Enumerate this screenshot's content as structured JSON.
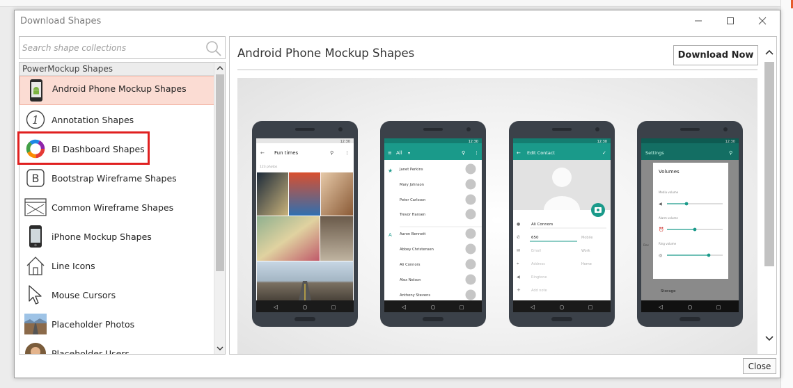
{
  "window": {
    "title": "Download Shapes"
  },
  "search": {
    "placeholder": "Search shape collections"
  },
  "sidebar": {
    "group_label": "PowerMockup Shapes",
    "items": [
      {
        "label": "Android Phone Mockup Shapes",
        "icon": "android-phone-icon",
        "selected": true
      },
      {
        "label": "Annotation Shapes",
        "icon": "annotation-number-icon"
      },
      {
        "label": "BI Dashboard Shapes",
        "icon": "donut-chart-icon"
      },
      {
        "label": "Bootstrap Wireframe Shapes",
        "icon": "bootstrap-b-icon"
      },
      {
        "label": "Common Wireframe Shapes",
        "icon": "wireframe-window-icon"
      },
      {
        "label": "iPhone Mockup Shapes",
        "icon": "iphone-icon"
      },
      {
        "label": "Line Icons",
        "icon": "house-outline-icon"
      },
      {
        "label": "Mouse Cursors",
        "icon": "cursor-arrow-icon"
      },
      {
        "label": "Placeholder Photos",
        "icon": "landscape-photo-icon"
      },
      {
        "label": "Placeholder Users",
        "icon": "user-photo-icon"
      }
    ]
  },
  "detail": {
    "title": "Android Phone Mockup Shapes",
    "download_label": "Download Now"
  },
  "phones": [
    {
      "status_time": "12:30",
      "appbar_title": "Fun times",
      "subtitle": "123 photos"
    },
    {
      "status_time": "12:30",
      "appbar_title": "All",
      "contacts": [
        "Janet Perkins",
        "Mary Johnson",
        "Peter Carlsson",
        "Trevor Hansen",
        "Aaron Bennett",
        "Abbey Christensen",
        "Ali Connors",
        "Alex Nelson",
        "Anthony Stevens"
      ],
      "section_letter": "A"
    },
    {
      "status_time": "12:30",
      "appbar_title": "Edit Contact",
      "name_value": "Ali Connors",
      "phone_value": "650",
      "phone_type": "Mobile",
      "email_placeholder": "Email",
      "email_type": "Work",
      "address_placeholder": "Address",
      "address_type": "Home",
      "ringtone_placeholder": "Ringtone",
      "note_placeholder": "Add note"
    },
    {
      "status_time": "12:30",
      "appbar_title": "Settings",
      "dialog_title": "Volumes",
      "sliders": [
        {
          "label": "Media volume",
          "value": 0.35
        },
        {
          "label": "Alarm volume",
          "value": 0.5
        },
        {
          "label": "Ring volume",
          "value": 0.75
        }
      ],
      "bottom_label": "Storage",
      "left_label": "Dev"
    }
  ],
  "footer": {
    "close_label": "Close"
  },
  "colors": {
    "teal": "#1a9a8a",
    "selected_bg": "#fbdcd3",
    "highlight": "#e02020"
  }
}
